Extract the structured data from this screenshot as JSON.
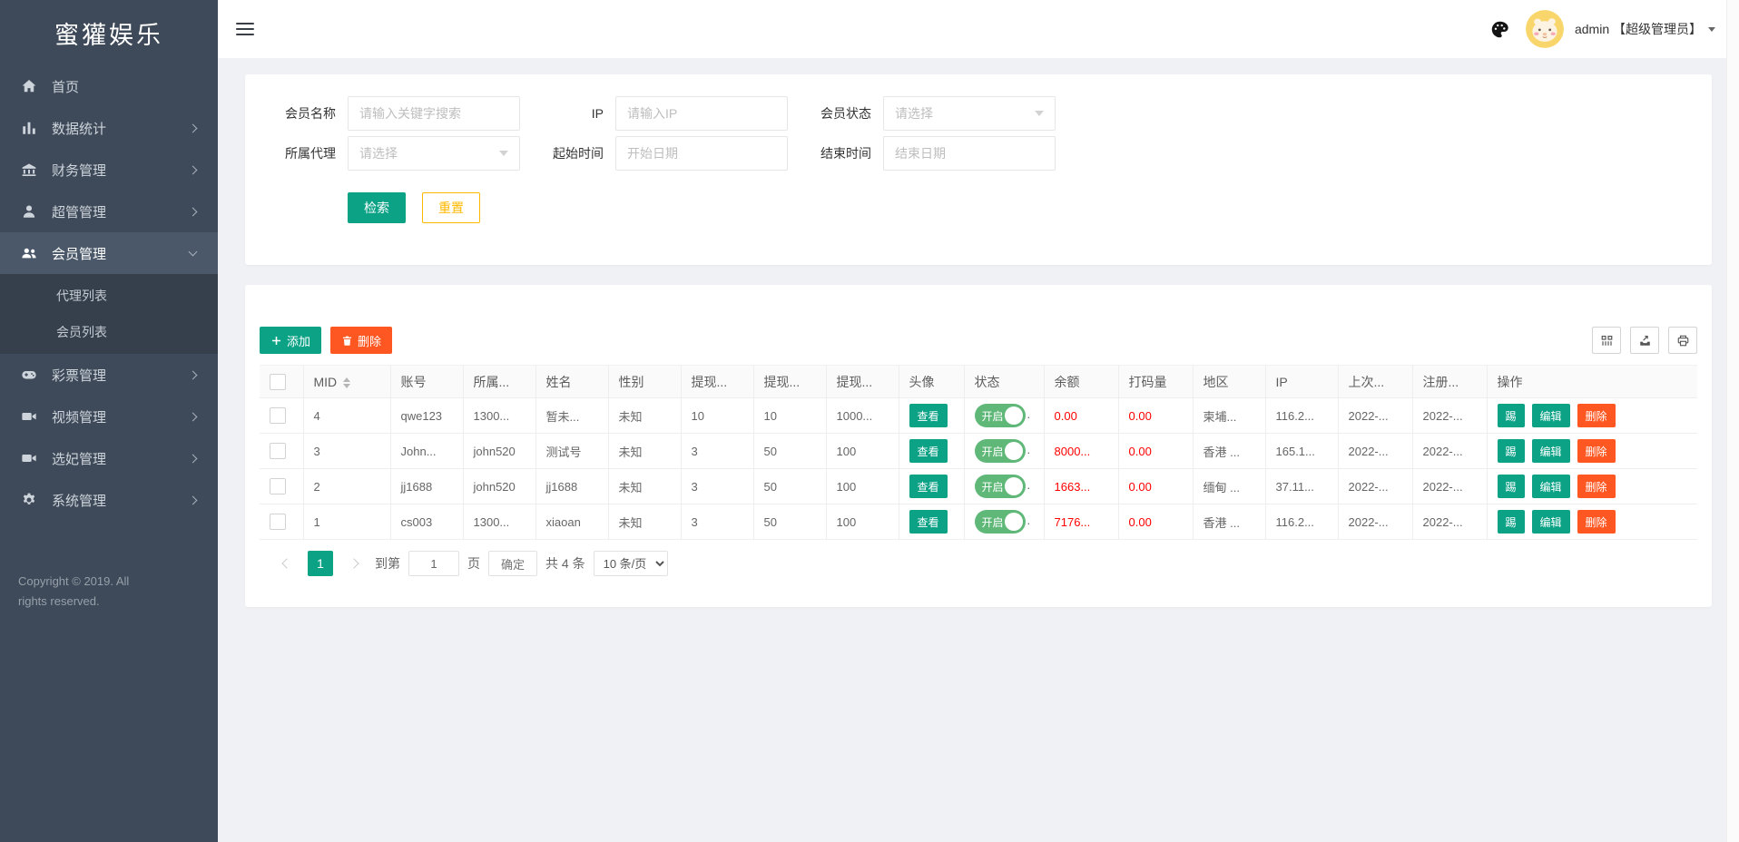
{
  "brand": {
    "title": "蜜獾娱乐"
  },
  "header": {
    "user_label": "admin 【超级管理员】",
    "icons": {
      "hamburger": "menu",
      "palette": "theme-palette",
      "avatar": "user-avatar",
      "caret": "dropdown-caret"
    }
  },
  "sidebar": {
    "items": [
      {
        "label": "首页",
        "icon": "home",
        "expandable": false
      },
      {
        "label": "数据统计",
        "icon": "chart",
        "expandable": true
      },
      {
        "label": "财务管理",
        "icon": "bank",
        "expandable": true
      },
      {
        "label": "超管管理",
        "icon": "user",
        "expandable": true
      },
      {
        "label": "会员管理",
        "icon": "users",
        "expandable": true,
        "active": true,
        "children": [
          "代理列表",
          "会员列表"
        ]
      },
      {
        "label": "彩票管理",
        "icon": "gamepad",
        "expandable": true
      },
      {
        "label": "视频管理",
        "icon": "video",
        "expandable": true
      },
      {
        "label": "选妃管理",
        "icon": "video",
        "expandable": true
      },
      {
        "label": "系统管理",
        "icon": "gear",
        "expandable": true
      }
    ],
    "copyright": "Copyright © 2019. All rights reserved."
  },
  "filters": {
    "fields": [
      {
        "label": "会员名称",
        "placeholder": "请输入关键字搜索",
        "type": "text"
      },
      {
        "label": "IP",
        "placeholder": "请输入IP",
        "type": "text"
      },
      {
        "label": "会员状态",
        "placeholder": "请选择",
        "type": "select"
      },
      {
        "label": "所属代理",
        "placeholder": "请选择",
        "type": "select"
      },
      {
        "label": "起始时间",
        "placeholder": "开始日期",
        "type": "text"
      },
      {
        "label": "结束时间",
        "placeholder": "结束日期",
        "type": "text"
      }
    ],
    "search_label": "检索",
    "reset_label": "重置"
  },
  "table": {
    "add_label": "添加",
    "delete_label": "删除",
    "view_label": "查看",
    "status_label": "开启",
    "status_suffix": ".",
    "actions": [
      "踢",
      "编辑",
      "删除"
    ],
    "columns": [
      {
        "label": "MID",
        "sortable": true
      },
      {
        "label": "账号"
      },
      {
        "label": "所属..."
      },
      {
        "label": "姓名"
      },
      {
        "label": "性别"
      },
      {
        "label": "提现..."
      },
      {
        "label": "提现..."
      },
      {
        "label": "提现..."
      },
      {
        "label": "头像"
      },
      {
        "label": "状态"
      },
      {
        "label": "余额"
      },
      {
        "label": "打码量"
      },
      {
        "label": "地区"
      },
      {
        "label": "IP"
      },
      {
        "label": "上次..."
      },
      {
        "label": "注册..."
      },
      {
        "label": "操作"
      }
    ],
    "rows": [
      {
        "mid": "4",
        "account": "qwe123",
        "agent": "1300...",
        "name": "暂未...",
        "gender": "未知",
        "withdraw1": "10",
        "withdraw2": "10",
        "withdraw3": "1000...",
        "balance": "0.00",
        "bet_amount": "0.00",
        "region": "柬埔...",
        "ip": "116.2...",
        "last_time": "2022-...",
        "reg_time": "2022-..."
      },
      {
        "mid": "3",
        "account": "John...",
        "agent": "john520",
        "name": "测试号",
        "gender": "未知",
        "withdraw1": "3",
        "withdraw2": "50",
        "withdraw3": "100",
        "balance": "8000...",
        "bet_amount": "0.00",
        "region": "香港 ...",
        "ip": "165.1...",
        "last_time": "2022-...",
        "reg_time": "2022-..."
      },
      {
        "mid": "2",
        "account": "jj1688",
        "agent": "john520",
        "name": "jj1688",
        "gender": "未知",
        "withdraw1": "3",
        "withdraw2": "50",
        "withdraw3": "100",
        "balance": "1663...",
        "bet_amount": "0.00",
        "region": "缅甸 ...",
        "ip": "37.11...",
        "last_time": "2022-...",
        "reg_time": "2022-..."
      },
      {
        "mid": "1",
        "account": "cs003",
        "agent": "1300...",
        "name": "xiaoan",
        "gender": "未知",
        "withdraw1": "3",
        "withdraw2": "50",
        "withdraw3": "100",
        "balance": "7176...",
        "bet_amount": "0.00",
        "region": "香港 ...",
        "ip": "116.2...",
        "last_time": "2022-...",
        "reg_time": "2022-..."
      }
    ]
  },
  "pagination": {
    "current": "1",
    "goto_label": "到第",
    "page_value": "1",
    "page_label": "页",
    "confirm_label": "确定",
    "total_label": "共 4 条",
    "per_page": "10 条/页"
  },
  "colors": {
    "teal": "#0BA286",
    "orange": "#FF5722",
    "yellow": "#FFB800",
    "toggle": "#5FB878",
    "red": "#FF0000",
    "sidebar": "#3E4A59",
    "sidebar-active": "#4A5869",
    "bg": "#F0F1F4"
  }
}
